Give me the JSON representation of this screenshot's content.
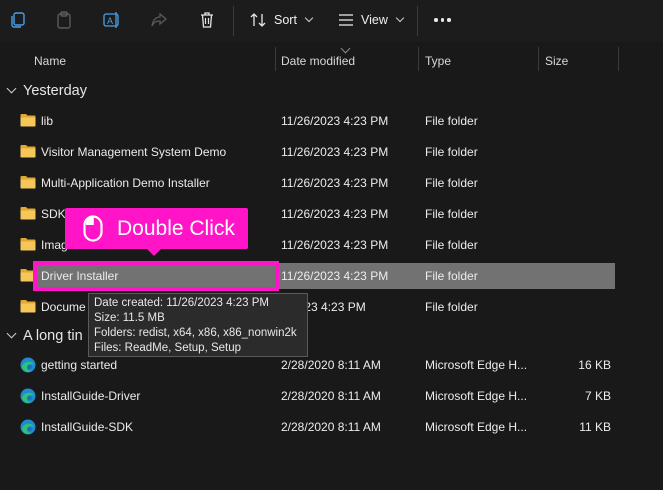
{
  "toolbar": {
    "icons": [
      "copy-icon",
      "paste-icon",
      "rename-icon",
      "share-icon",
      "delete-icon"
    ],
    "sort_label": "Sort",
    "view_label": "View",
    "more": "more-options-icon"
  },
  "columns": {
    "name": "Name",
    "date": "Date modified",
    "type": "Type",
    "size": "Size"
  },
  "groups": {
    "yesterday": "Yesterday",
    "long_time": "A long tin"
  },
  "yesterday_rows": [
    {
      "name": "lib",
      "date": "11/26/2023 4:23 PM",
      "type": "File folder",
      "size": ""
    },
    {
      "name": "Visitor Management System Demo",
      "date": "11/26/2023 4:23 PM",
      "type": "File folder",
      "size": ""
    },
    {
      "name": "Multi-Application Demo Installer",
      "date": "11/26/2023 4:23 PM",
      "type": "File folder",
      "size": ""
    },
    {
      "name": "SDK",
      "date": "11/26/2023 4:23 PM",
      "type": "File folder",
      "size": ""
    },
    {
      "name": "Imag",
      "date": "11/26/2023 4:23 PM",
      "type": "File folder",
      "size": ""
    },
    {
      "name": "Driver Installer",
      "date": "11/26/2023 4:23 PM",
      "type": "File folder",
      "size": ""
    },
    {
      "name": "Docume",
      "date": "5/2023 4:23 PM",
      "type": "File folder",
      "size": ""
    }
  ],
  "old_rows": [
    {
      "name": "getting started",
      "date": "2/28/2020 8:11 AM",
      "type": "Microsoft Edge H...",
      "size": "16 KB"
    },
    {
      "name": "InstallGuide-Driver",
      "date": "2/28/2020 8:11 AM",
      "type": "Microsoft Edge H...",
      "size": "7 KB"
    },
    {
      "name": "InstallGuide-SDK",
      "date": "2/28/2020 8:11 AM",
      "type": "Microsoft Edge H...",
      "size": "11 KB"
    }
  ],
  "callout": {
    "text": "Double Click",
    "icon": "mouse-icon"
  },
  "tooltip": {
    "created": "Date created: 11/26/2023 4:23 PM",
    "size": "Size: 11.5 MB",
    "folders": "Folders: redist, x64, x86, x86_nonwin2k",
    "files": "Files: ReadMe, Setup, Setup"
  },
  "colors": {
    "accent": "#ff14c8",
    "folder": "#f2c14e",
    "selected_row": "#727272",
    "edge_blue": "#1f8ad2",
    "edge_green": "#2fc07a"
  }
}
